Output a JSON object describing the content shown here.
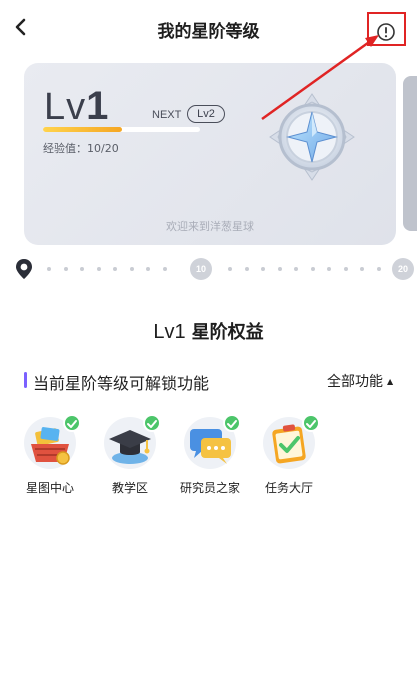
{
  "header": {
    "title": "我的星阶等级",
    "back_icon": "chevron-left-icon",
    "info_icon": "exclamation-circle-icon"
  },
  "level_card": {
    "level_prefix": "Lv",
    "level_number": "1",
    "next_label": "NEXT",
    "next_level": "Lv2",
    "exp_text": "经验值：10/20",
    "exp_progress": 0.5,
    "slogan": "欢迎来到洋葱星球",
    "badge_icon": "star-compass-badge-icon"
  },
  "timeline": {
    "nodes": [
      "10",
      "20"
    ]
  },
  "benefits": {
    "level_label": "Lv1",
    "title": "星阶权益"
  },
  "section": {
    "title": "当前星阶等级可解锁功能",
    "all_label": "全部功能"
  },
  "features": [
    {
      "label": "星图中心",
      "icon": "basket-icon",
      "unlocked": true
    },
    {
      "label": "教学区",
      "icon": "graduation-cap-icon",
      "unlocked": true
    },
    {
      "label": "研究员之家",
      "icon": "chat-bubble-icon",
      "unlocked": true
    },
    {
      "label": "任务大厅",
      "icon": "checklist-icon",
      "unlocked": true
    }
  ],
  "colors": {
    "accent_purple": "#7b61ff",
    "check_green": "#4cc56a",
    "annotation_red": "#e02424",
    "progress_yellow": "#f5a623"
  }
}
